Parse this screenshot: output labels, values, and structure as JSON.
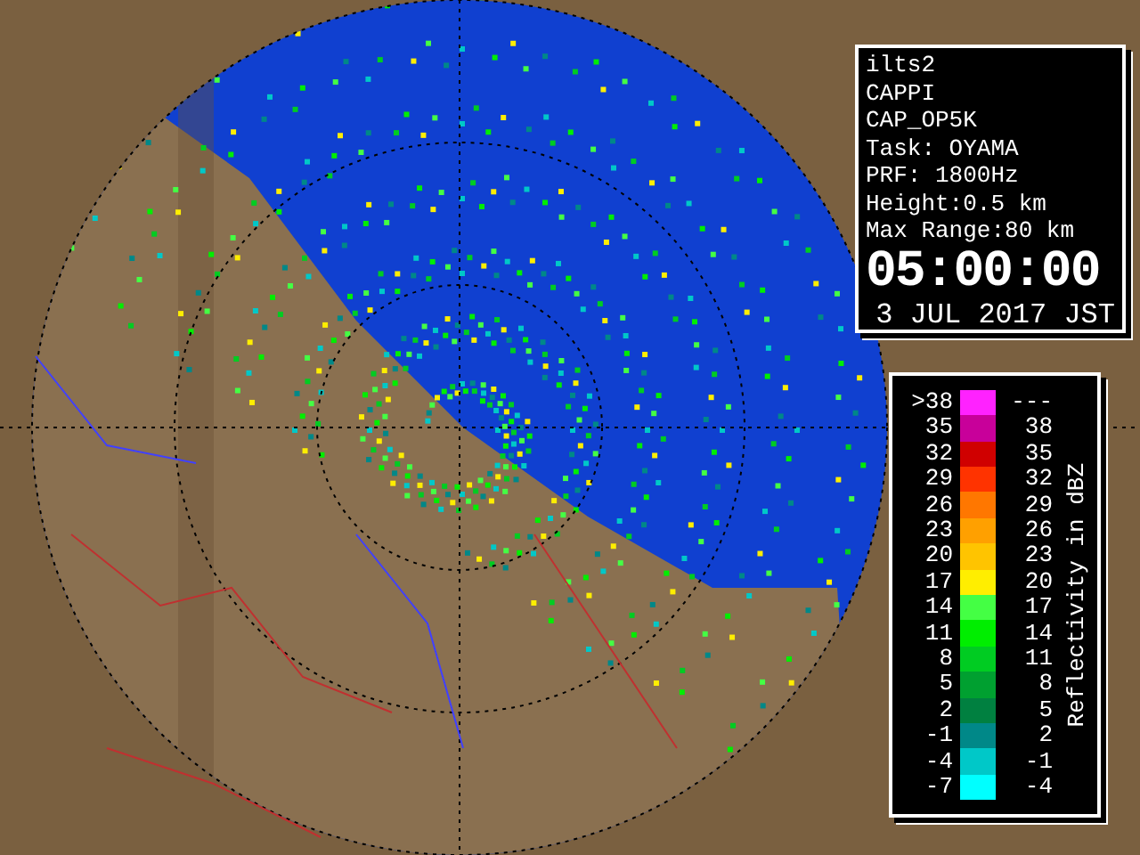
{
  "info_panel": {
    "lines": [
      "ilts2",
      "CAPPI",
      "CAP_OP5K",
      "Task: OYAMA",
      "PRF: 1800Hz",
      "Height:0.5 km",
      "Max Range:80 km"
    ],
    "time": "05:00:00",
    "date": "3 JUL 2017 JST"
  },
  "legend": {
    "title": "Reflectivity in dBZ",
    "rows": [
      {
        "low": ">38",
        "high": "---",
        "color": "#ff22ff"
      },
      {
        "low": "35",
        "high": "38",
        "color": "#c8009a"
      },
      {
        "low": "32",
        "high": "35",
        "color": "#d00000"
      },
      {
        "low": "29",
        "high": "32",
        "color": "#ff3300"
      },
      {
        "low": "26",
        "high": "29",
        "color": "#ff7700"
      },
      {
        "low": "23",
        "high": "26",
        "color": "#ffa000"
      },
      {
        "low": "20",
        "high": "23",
        "color": "#ffc400"
      },
      {
        "low": "17",
        "high": "20",
        "color": "#ffee00"
      },
      {
        "low": "14",
        "high": "17",
        "color": "#44ff44"
      },
      {
        "low": "11",
        "high": "14",
        "color": "#00ee00"
      },
      {
        "low": "8",
        "high": "11",
        "color": "#00cc22"
      },
      {
        "low": "5",
        "high": "8",
        "color": "#00a030"
      },
      {
        "low": "2",
        "high": "5",
        "color": "#008040"
      },
      {
        "low": "-1",
        "high": "2",
        "color": "#008888"
      },
      {
        "low": "-4",
        "high": "-1",
        "color": "#00c8c8"
      },
      {
        "low": "-7",
        "high": "-4",
        "color": "#00ffff"
      }
    ]
  }
}
